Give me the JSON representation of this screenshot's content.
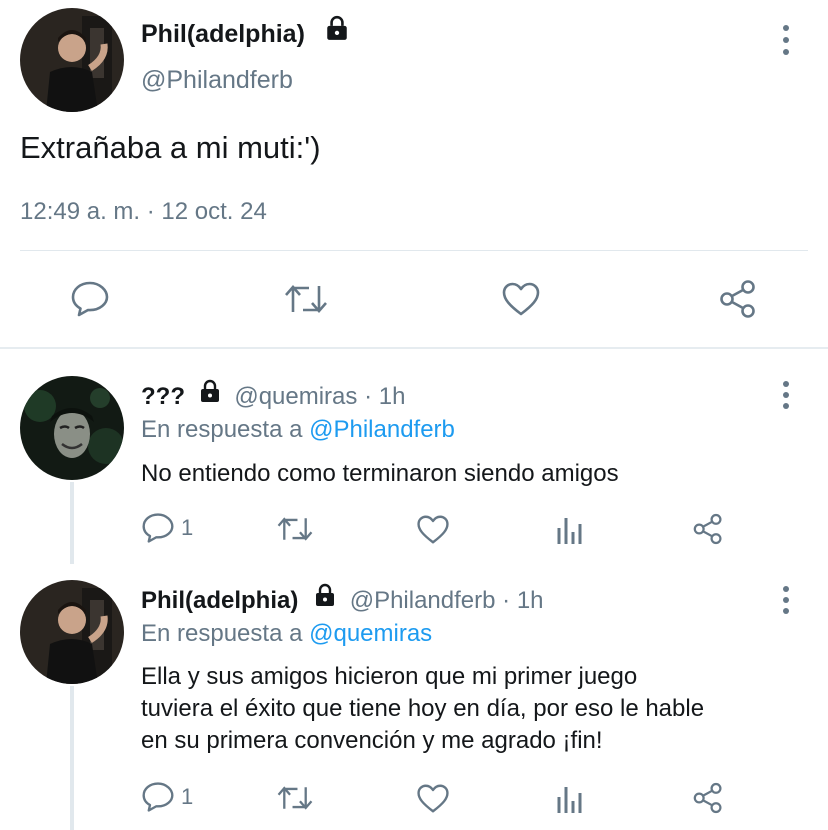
{
  "main_tweet": {
    "display_name": "Phil(adelphia)",
    "handle": "@Philandferb",
    "text": "Extrañaba a mi muti:')",
    "timestamp": "12:49 a. m. · 12 oct. 24",
    "actions": [
      "reply-icon",
      "retweet-icon",
      "like-icon",
      "share-icon"
    ]
  },
  "replies": [
    {
      "display_name": "???",
      "handle": "@quemiras",
      "time": "· 1h",
      "reply_prefix": "En respuesta a",
      "reply_to": "@Philandferb",
      "text_lines": [
        "No entiendo como terminaron siendo amigos"
      ],
      "reply_count": "1"
    },
    {
      "display_name": "Phil(adelphia)",
      "handle": "@Philandferb",
      "time": "· 1h",
      "reply_prefix": "En respuesta a",
      "reply_to": "@quemiras",
      "text_lines": [
        "Ella y sus amigos hicieron que mi primer juego",
        "tuviera el éxito que tiene hoy en día, por eso le hable",
        "en su primera convención y me agrado ¡fin!"
      ],
      "reply_count": "1"
    }
  ],
  "colors": {
    "text": "#14171a",
    "secondary": "#657786",
    "link": "#1d9bf0",
    "divider": "#e1e8ed"
  }
}
